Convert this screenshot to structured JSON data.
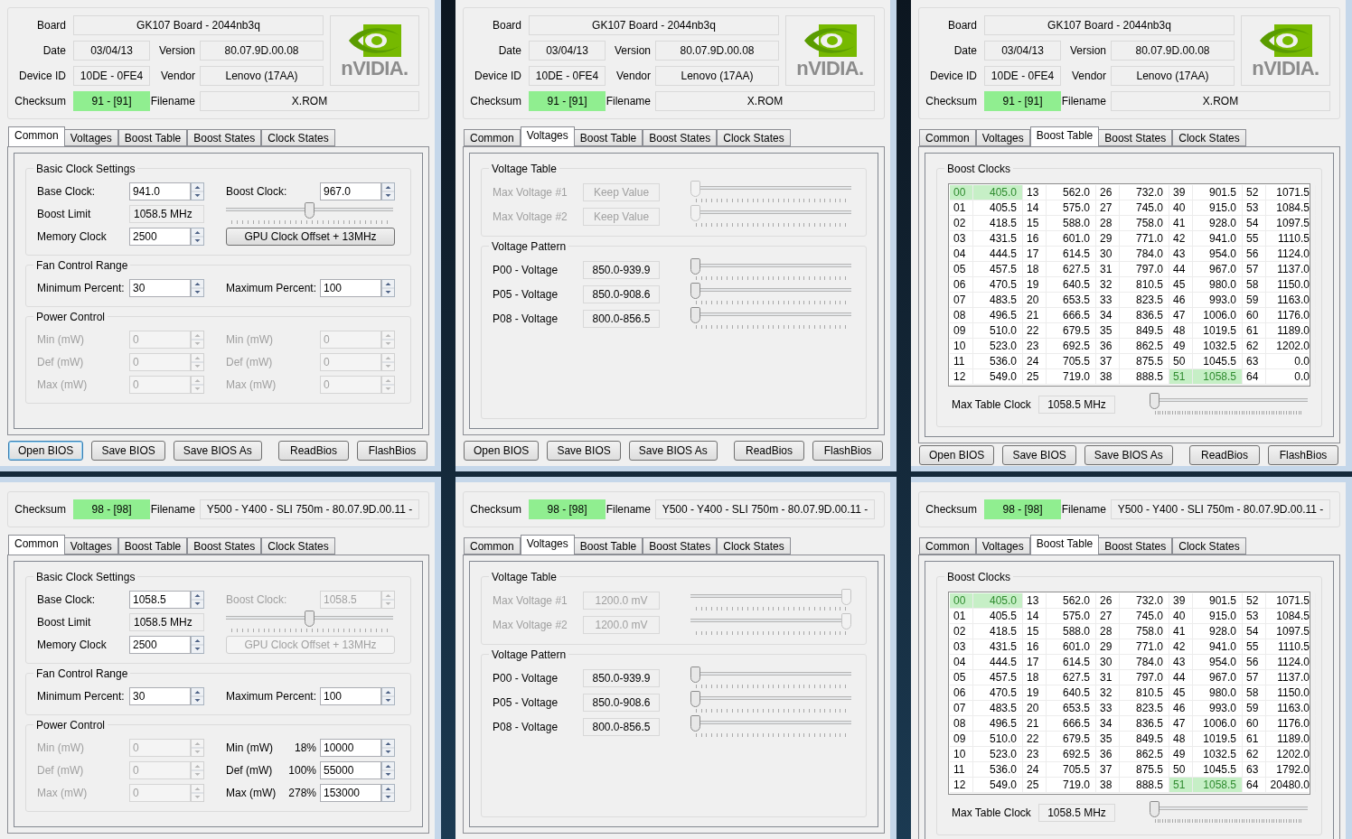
{
  "windows": [
    {
      "header": {
        "rows": [
          [
            {
              "label": "Board",
              "value": "GK107 Board - 2044nb3q"
            }
          ],
          [
            {
              "label": "Date",
              "value": "03/04/13"
            },
            {
              "label": "Version",
              "value": "80.07.9D.00.08"
            }
          ],
          [
            {
              "label": "Device ID",
              "value": "10DE - 0FE4"
            },
            {
              "label": "Vendor",
              "value": "Lenovo (17AA)"
            }
          ],
          [
            {
              "label": "Checksum",
              "value": "91 - [91]",
              "ok": true
            },
            {
              "label": "Filename",
              "value": "X.ROM"
            }
          ]
        ],
        "logo": {
          "text": "nVIDIA."
        }
      },
      "tabs": [
        {
          "label": "Common",
          "selected": true
        },
        {
          "label": "Voltages",
          "selected": false
        },
        {
          "label": "Boost Table",
          "selected": false
        },
        {
          "label": "Boost States",
          "selected": false
        },
        {
          "label": "Clock States",
          "selected": false
        }
      ],
      "content": {
        "kind": "common",
        "groups": [
          {
            "title": "Basic Clock Settings",
            "rows": [
              [
                {
                  "kind": "spin",
                  "label": "Base Clock:",
                  "value": "941.0",
                  "disabled": false
                },
                {
                  "kind": "spin",
                  "label": "Boost Clock:",
                  "value": "967.0",
                  "disabled": false
                }
              ],
              [
                {
                  "kind": "readonly",
                  "label": "Boost Limit",
                  "value": "1058.5 MHz"
                },
                {
                  "kind": "slider",
                  "level": 0.5
                }
              ],
              [
                {
                  "kind": "spin",
                  "label": "Memory Clock",
                  "value": "2500",
                  "disabled": false
                },
                {
                  "kind": "button",
                  "label": "GPU Clock Offset + 13MHz",
                  "disabled": false
                }
              ]
            ]
          },
          {
            "title": "Fan Control Range",
            "rows": [
              [
                {
                  "kind": "spin",
                  "label": "Minimum Percent:",
                  "value": "30",
                  "disabled": false
                },
                {
                  "kind": "spin",
                  "label": "Maximum Percent:",
                  "value": "100",
                  "disabled": false
                }
              ]
            ]
          },
          {
            "title": "Power Control",
            "rows": [
              [
                {
                  "kind": "spin",
                  "label": "Min (mW)",
                  "value": "0",
                  "disabled": true
                },
                {
                  "kind": "spin",
                  "label": "Min (mW)",
                  "value": "0",
                  "disabled": true
                }
              ],
              [
                {
                  "kind": "spin",
                  "label": "Def (mW)",
                  "value": "0",
                  "disabled": true
                },
                {
                  "kind": "spin",
                  "label": "Def (mW)",
                  "value": "0",
                  "disabled": true
                }
              ],
              [
                {
                  "kind": "spin",
                  "label": "Max (mW)",
                  "value": "0",
                  "disabled": true
                },
                {
                  "kind": "spin",
                  "label": "Max (mW)",
                  "value": "0",
                  "disabled": true
                }
              ]
            ]
          }
        ]
      },
      "buttons_left": [
        {
          "label": "Open BIOS",
          "focused": true
        },
        {
          "label": "Save BIOS",
          "focused": false
        },
        {
          "label": "Save BIOS As",
          "focused": false
        }
      ],
      "buttons_right": [
        {
          "label": "ReadBios",
          "focused": false
        },
        {
          "label": "FlashBios",
          "focused": false
        }
      ]
    },
    {
      "header": {
        "rows": [
          [
            {
              "label": "Board",
              "value": "GK107 Board - 2044nb3q"
            }
          ],
          [
            {
              "label": "Date",
              "value": "03/04/13"
            },
            {
              "label": "Version",
              "value": "80.07.9D.00.08"
            }
          ],
          [
            {
              "label": "Device ID",
              "value": "10DE - 0FE4"
            },
            {
              "label": "Vendor",
              "value": "Lenovo (17AA)"
            }
          ],
          [
            {
              "label": "Checksum",
              "value": "91 - [91]",
              "ok": true
            },
            {
              "label": "Filename",
              "value": "X.ROM"
            }
          ]
        ],
        "logo": {
          "text": "nVIDIA."
        }
      },
      "tabs": [
        {
          "label": "Common",
          "selected": false
        },
        {
          "label": "Voltages",
          "selected": true
        },
        {
          "label": "Boost Table",
          "selected": false
        },
        {
          "label": "Boost States",
          "selected": false
        },
        {
          "label": "Clock States",
          "selected": false
        }
      ],
      "content": {
        "kind": "voltages",
        "groups": [
          {
            "title": "Voltage Table",
            "rows": [
              {
                "label": "Max Voltage #1",
                "value": "Keep Value",
                "level": 0,
                "disabled": true
              },
              {
                "label": "Max Voltage #2",
                "value": "Keep Value",
                "level": 0,
                "disabled": true
              }
            ]
          },
          {
            "title": "Voltage Pattern",
            "rows": [
              {
                "label": "P00 - Voltage",
                "value": "850.0-939.9",
                "level": 0,
                "disabled": false
              },
              {
                "label": "P05 - Voltage",
                "value": "850.0-908.6",
                "level": 0,
                "disabled": false
              },
              {
                "label": "P08 - Voltage",
                "value": "800.0-856.5",
                "level": 0,
                "disabled": false
              }
            ]
          }
        ]
      },
      "buttons_left": [
        {
          "label": "Open BIOS",
          "focused": false
        },
        {
          "label": "Save BIOS",
          "focused": false
        },
        {
          "label": "Save BIOS As",
          "focused": false
        }
      ],
      "buttons_right": [
        {
          "label": "ReadBios",
          "focused": false
        },
        {
          "label": "FlashBios",
          "focused": false
        }
      ]
    },
    {
      "header": {
        "rows": [
          [
            {
              "label": "Board",
              "value": "GK107 Board - 2044nb3q"
            }
          ],
          [
            {
              "label": "Date",
              "value": "03/04/13"
            },
            {
              "label": "Version",
              "value": "80.07.9D.00.08"
            }
          ],
          [
            {
              "label": "Device ID",
              "value": "10DE - 0FE4"
            },
            {
              "label": "Vendor",
              "value": "Lenovo (17AA)"
            }
          ],
          [
            {
              "label": "Checksum",
              "value": "91 - [91]",
              "ok": true
            },
            {
              "label": "Filename",
              "value": "X.ROM"
            }
          ]
        ],
        "logo": {
          "text": "nVIDIA."
        }
      },
      "tabs": [
        {
          "label": "Common",
          "selected": false
        },
        {
          "label": "Voltages",
          "selected": false
        },
        {
          "label": "Boost Table",
          "selected": true
        },
        {
          "label": "Boost States",
          "selected": false
        },
        {
          "label": "Clock States",
          "selected": false
        }
      ],
      "content": {
        "kind": "boost_table",
        "title": "Boost Clocks",
        "rows": [
          [
            {
              "index": "00",
              "value": "405.0",
              "selected": true
            },
            {
              "index": "13",
              "value": "562.0",
              "selected": false
            },
            {
              "index": "26",
              "value": "732.0",
              "selected": false
            },
            {
              "index": "39",
              "value": "901.5",
              "selected": false
            },
            {
              "index": "52",
              "value": "1071.5",
              "selected": false
            }
          ],
          [
            {
              "index": "01",
              "value": "405.5",
              "selected": false
            },
            {
              "index": "14",
              "value": "575.0",
              "selected": false
            },
            {
              "index": "27",
              "value": "745.0",
              "selected": false
            },
            {
              "index": "40",
              "value": "915.0",
              "selected": false
            },
            {
              "index": "53",
              "value": "1084.5",
              "selected": false
            }
          ],
          [
            {
              "index": "02",
              "value": "418.5",
              "selected": false
            },
            {
              "index": "15",
              "value": "588.0",
              "selected": false
            },
            {
              "index": "28",
              "value": "758.0",
              "selected": false
            },
            {
              "index": "41",
              "value": "928.0",
              "selected": false
            },
            {
              "index": "54",
              "value": "1097.5",
              "selected": false
            }
          ],
          [
            {
              "index": "03",
              "value": "431.5",
              "selected": false
            },
            {
              "index": "16",
              "value": "601.0",
              "selected": false
            },
            {
              "index": "29",
              "value": "771.0",
              "selected": false
            },
            {
              "index": "42",
              "value": "941.0",
              "selected": false
            },
            {
              "index": "55",
              "value": "1110.5",
              "selected": false
            }
          ],
          [
            {
              "index": "04",
              "value": "444.5",
              "selected": false
            },
            {
              "index": "17",
              "value": "614.5",
              "selected": false
            },
            {
              "index": "30",
              "value": "784.0",
              "selected": false
            },
            {
              "index": "43",
              "value": "954.0",
              "selected": false
            },
            {
              "index": "56",
              "value": "1124.0",
              "selected": false
            }
          ],
          [
            {
              "index": "05",
              "value": "457.5",
              "selected": false
            },
            {
              "index": "18",
              "value": "627.5",
              "selected": false
            },
            {
              "index": "31",
              "value": "797.0",
              "selected": false
            },
            {
              "index": "44",
              "value": "967.0",
              "selected": false
            },
            {
              "index": "57",
              "value": "1137.0",
              "selected": false
            }
          ],
          [
            {
              "index": "06",
              "value": "470.5",
              "selected": false
            },
            {
              "index": "19",
              "value": "640.5",
              "selected": false
            },
            {
              "index": "32",
              "value": "810.5",
              "selected": false
            },
            {
              "index": "45",
              "value": "980.0",
              "selected": false
            },
            {
              "index": "58",
              "value": "1150.0",
              "selected": false
            }
          ],
          [
            {
              "index": "07",
              "value": "483.5",
              "selected": false
            },
            {
              "index": "20",
              "value": "653.5",
              "selected": false
            },
            {
              "index": "33",
              "value": "823.5",
              "selected": false
            },
            {
              "index": "46",
              "value": "993.0",
              "selected": false
            },
            {
              "index": "59",
              "value": "1163.0",
              "selected": false
            }
          ],
          [
            {
              "index": "08",
              "value": "496.5",
              "selected": false
            },
            {
              "index": "21",
              "value": "666.5",
              "selected": false
            },
            {
              "index": "34",
              "value": "836.5",
              "selected": false
            },
            {
              "index": "47",
              "value": "1006.0",
              "selected": false
            },
            {
              "index": "60",
              "value": "1176.0",
              "selected": false
            }
          ],
          [
            {
              "index": "09",
              "value": "510.0",
              "selected": false
            },
            {
              "index": "22",
              "value": "679.5",
              "selected": false
            },
            {
              "index": "35",
              "value": "849.5",
              "selected": false
            },
            {
              "index": "48",
              "value": "1019.5",
              "selected": false
            },
            {
              "index": "61",
              "value": "1189.0",
              "selected": false
            }
          ],
          [
            {
              "index": "10",
              "value": "523.0",
              "selected": false
            },
            {
              "index": "23",
              "value": "692.5",
              "selected": false
            },
            {
              "index": "36",
              "value": "862.5",
              "selected": false
            },
            {
              "index": "49",
              "value": "1032.5",
              "selected": false
            },
            {
              "index": "62",
              "value": "1202.0",
              "selected": false
            }
          ],
          [
            {
              "index": "11",
              "value": "536.0",
              "selected": false
            },
            {
              "index": "24",
              "value": "705.5",
              "selected": false
            },
            {
              "index": "37",
              "value": "875.5",
              "selected": false
            },
            {
              "index": "50",
              "value": "1045.5",
              "selected": false
            },
            {
              "index": "63",
              "value": "0.0",
              "selected": false
            }
          ],
          [
            {
              "index": "12",
              "value": "549.0",
              "selected": false
            },
            {
              "index": "25",
              "value": "719.0",
              "selected": false
            },
            {
              "index": "38",
              "value": "888.5",
              "selected": false
            },
            {
              "index": "51",
              "value": "1058.5",
              "selected": true
            },
            {
              "index": "64",
              "value": "0.0",
              "selected": false
            }
          ]
        ],
        "max_label": "Max Table Clock",
        "max_value": "1058.5 MHz",
        "max_slider": {
          "level": 0
        }
      },
      "buttons_left": [
        {
          "label": "Open BIOS",
          "focused": false
        },
        {
          "label": "Save BIOS",
          "focused": false
        },
        {
          "label": "Save BIOS As",
          "focused": false
        }
      ],
      "buttons_right": [
        {
          "label": "ReadBios",
          "focused": false
        },
        {
          "label": "FlashBios",
          "focused": false
        }
      ]
    },
    {
      "header": {
        "rows": [
          [
            {
              "label": "Checksum",
              "value": "98 - [98]",
              "ok": true
            },
            {
              "label": "Filename",
              "value": "Y500 - Y400 - SLI 750m - 80.07.9D.00.11 -"
            }
          ]
        ]
      },
      "tabs": [
        {
          "label": "Common",
          "selected": true
        },
        {
          "label": "Voltages",
          "selected": false
        },
        {
          "label": "Boost Table",
          "selected": false
        },
        {
          "label": "Boost States",
          "selected": false
        },
        {
          "label": "Clock States",
          "selected": false
        }
      ],
      "content": {
        "kind": "common",
        "groups": [
          {
            "title": "Basic Clock Settings",
            "rows": [
              [
                {
                  "kind": "spin",
                  "label": "Base Clock:",
                  "value": "1058.5",
                  "disabled": false
                },
                {
                  "kind": "spin",
                  "label": "Boost Clock:",
                  "value": "1058.5",
                  "disabled": true
                }
              ],
              [
                {
                  "kind": "readonly",
                  "label": "Boost Limit",
                  "value": "1058.5 MHz"
                },
                {
                  "kind": "slider",
                  "level": 0.5
                }
              ],
              [
                {
                  "kind": "spin",
                  "label": "Memory Clock",
                  "value": "2500",
                  "disabled": false
                },
                {
                  "kind": "button",
                  "label": "GPU Clock Offset + 13MHz",
                  "disabled": true
                }
              ]
            ]
          },
          {
            "title": "Fan Control Range",
            "rows": [
              [
                {
                  "kind": "spin",
                  "label": "Minimum Percent:",
                  "value": "30",
                  "disabled": false
                },
                {
                  "kind": "spin",
                  "label": "Maximum Percent:",
                  "value": "100",
                  "disabled": false
                }
              ]
            ]
          },
          {
            "title": "Power Control",
            "rows": [
              [
                {
                  "kind": "spin",
                  "label": "Min (mW)",
                  "value": "0",
                  "disabled": true
                },
                {
                  "kind": "spin",
                  "label": "Min (mW)",
                  "percent": "18%",
                  "value": "10000",
                  "disabled": false
                }
              ],
              [
                {
                  "kind": "spin",
                  "label": "Def (mW)",
                  "value": "0",
                  "disabled": true
                },
                {
                  "kind": "spin",
                  "label": "Def (mW)",
                  "percent": "100%",
                  "value": "55000",
                  "disabled": false
                }
              ],
              [
                {
                  "kind": "spin",
                  "label": "Max (mW)",
                  "value": "0",
                  "disabled": true
                },
                {
                  "kind": "spin",
                  "label": "Max (mW)",
                  "percent": "278%",
                  "value": "153000",
                  "disabled": false
                }
              ]
            ]
          }
        ]
      }
    },
    {
      "header": {
        "rows": [
          [
            {
              "label": "Checksum",
              "value": "98 - [98]",
              "ok": true
            },
            {
              "label": "Filename",
              "value": "Y500 - Y400 - SLI 750m - 80.07.9D.00.11 -"
            }
          ]
        ]
      },
      "tabs": [
        {
          "label": "Common",
          "selected": false
        },
        {
          "label": "Voltages",
          "selected": true
        },
        {
          "label": "Boost Table",
          "selected": false
        },
        {
          "label": "Boost States",
          "selected": false
        },
        {
          "label": "Clock States",
          "selected": false
        }
      ],
      "content": {
        "kind": "voltages",
        "groups": [
          {
            "title": "Voltage Table",
            "rows": [
              {
                "label": "Max Voltage #1",
                "value": "1200.0 mV",
                "level": 1,
                "disabled": true
              },
              {
                "label": "Max Voltage #2",
                "value": "1200.0 mV",
                "level": 1,
                "disabled": true
              }
            ]
          },
          {
            "title": "Voltage Pattern",
            "rows": [
              {
                "label": "P00 - Voltage",
                "value": "850.0-939.9",
                "level": 0,
                "disabled": false
              },
              {
                "label": "P05 - Voltage",
                "value": "850.0-908.6",
                "level": 0,
                "disabled": false
              },
              {
                "label": "P08 - Voltage",
                "value": "800.0-856.5",
                "level": 0,
                "disabled": false
              }
            ]
          }
        ]
      }
    },
    {
      "header": {
        "rows": [
          [
            {
              "label": "Checksum",
              "value": "98 - [98]",
              "ok": true
            },
            {
              "label": "Filename",
              "value": "Y500 - Y400 - SLI 750m - 80.07.9D.00.11 -"
            }
          ]
        ]
      },
      "tabs": [
        {
          "label": "Common",
          "selected": false
        },
        {
          "label": "Voltages",
          "selected": false
        },
        {
          "label": "Boost Table",
          "selected": true
        },
        {
          "label": "Boost States",
          "selected": false
        },
        {
          "label": "Clock States",
          "selected": false
        }
      ],
      "content": {
        "kind": "boost_table",
        "title": "Boost Clocks",
        "rows": [
          [
            {
              "index": "00",
              "value": "405.0",
              "selected": true
            },
            {
              "index": "13",
              "value": "562.0",
              "selected": false
            },
            {
              "index": "26",
              "value": "732.0",
              "selected": false
            },
            {
              "index": "39",
              "value": "901.5",
              "selected": false
            },
            {
              "index": "52",
              "value": "1071.5",
              "selected": false
            }
          ],
          [
            {
              "index": "01",
              "value": "405.5",
              "selected": false
            },
            {
              "index": "14",
              "value": "575.0",
              "selected": false
            },
            {
              "index": "27",
              "value": "745.0",
              "selected": false
            },
            {
              "index": "40",
              "value": "915.0",
              "selected": false
            },
            {
              "index": "53",
              "value": "1084.5",
              "selected": false
            }
          ],
          [
            {
              "index": "02",
              "value": "418.5",
              "selected": false
            },
            {
              "index": "15",
              "value": "588.0",
              "selected": false
            },
            {
              "index": "28",
              "value": "758.0",
              "selected": false
            },
            {
              "index": "41",
              "value": "928.0",
              "selected": false
            },
            {
              "index": "54",
              "value": "1097.5",
              "selected": false
            }
          ],
          [
            {
              "index": "03",
              "value": "431.5",
              "selected": false
            },
            {
              "index": "16",
              "value": "601.0",
              "selected": false
            },
            {
              "index": "29",
              "value": "771.0",
              "selected": false
            },
            {
              "index": "42",
              "value": "941.0",
              "selected": false
            },
            {
              "index": "55",
              "value": "1110.5",
              "selected": false
            }
          ],
          [
            {
              "index": "04",
              "value": "444.5",
              "selected": false
            },
            {
              "index": "17",
              "value": "614.5",
              "selected": false
            },
            {
              "index": "30",
              "value": "784.0",
              "selected": false
            },
            {
              "index": "43",
              "value": "954.0",
              "selected": false
            },
            {
              "index": "56",
              "value": "1124.0",
              "selected": false
            }
          ],
          [
            {
              "index": "05",
              "value": "457.5",
              "selected": false
            },
            {
              "index": "18",
              "value": "627.5",
              "selected": false
            },
            {
              "index": "31",
              "value": "797.0",
              "selected": false
            },
            {
              "index": "44",
              "value": "967.0",
              "selected": false
            },
            {
              "index": "57",
              "value": "1137.0",
              "selected": false
            }
          ],
          [
            {
              "index": "06",
              "value": "470.5",
              "selected": false
            },
            {
              "index": "19",
              "value": "640.5",
              "selected": false
            },
            {
              "index": "32",
              "value": "810.5",
              "selected": false
            },
            {
              "index": "45",
              "value": "980.0",
              "selected": false
            },
            {
              "index": "58",
              "value": "1150.0",
              "selected": false
            }
          ],
          [
            {
              "index": "07",
              "value": "483.5",
              "selected": false
            },
            {
              "index": "20",
              "value": "653.5",
              "selected": false
            },
            {
              "index": "33",
              "value": "823.5",
              "selected": false
            },
            {
              "index": "46",
              "value": "993.0",
              "selected": false
            },
            {
              "index": "59",
              "value": "1163.0",
              "selected": false
            }
          ],
          [
            {
              "index": "08",
              "value": "496.5",
              "selected": false
            },
            {
              "index": "21",
              "value": "666.5",
              "selected": false
            },
            {
              "index": "34",
              "value": "836.5",
              "selected": false
            },
            {
              "index": "47",
              "value": "1006.0",
              "selected": false
            },
            {
              "index": "60",
              "value": "1176.0",
              "selected": false
            }
          ],
          [
            {
              "index": "09",
              "value": "510.0",
              "selected": false
            },
            {
              "index": "22",
              "value": "679.5",
              "selected": false
            },
            {
              "index": "35",
              "value": "849.5",
              "selected": false
            },
            {
              "index": "48",
              "value": "1019.5",
              "selected": false
            },
            {
              "index": "61",
              "value": "1189.0",
              "selected": false
            }
          ],
          [
            {
              "index": "10",
              "value": "523.0",
              "selected": false
            },
            {
              "index": "23",
              "value": "692.5",
              "selected": false
            },
            {
              "index": "36",
              "value": "862.5",
              "selected": false
            },
            {
              "index": "49",
              "value": "1032.5",
              "selected": false
            },
            {
              "index": "62",
              "value": "1202.0",
              "selected": false
            }
          ],
          [
            {
              "index": "11",
              "value": "536.0",
              "selected": false
            },
            {
              "index": "24",
              "value": "705.5",
              "selected": false
            },
            {
              "index": "37",
              "value": "875.5",
              "selected": false
            },
            {
              "index": "50",
              "value": "1045.5",
              "selected": false
            },
            {
              "index": "63",
              "value": "1792.0",
              "selected": false
            }
          ],
          [
            {
              "index": "12",
              "value": "549.0",
              "selected": false
            },
            {
              "index": "25",
              "value": "719.0",
              "selected": false
            },
            {
              "index": "38",
              "value": "888.5",
              "selected": false
            },
            {
              "index": "51",
              "value": "1058.5",
              "selected": true
            },
            {
              "index": "64",
              "value": "20480.0",
              "selected": false
            }
          ]
        ],
        "max_label": "Max Table Clock",
        "max_value": "1058.5 MHz",
        "max_slider": {
          "level": 0
        }
      }
    }
  ]
}
